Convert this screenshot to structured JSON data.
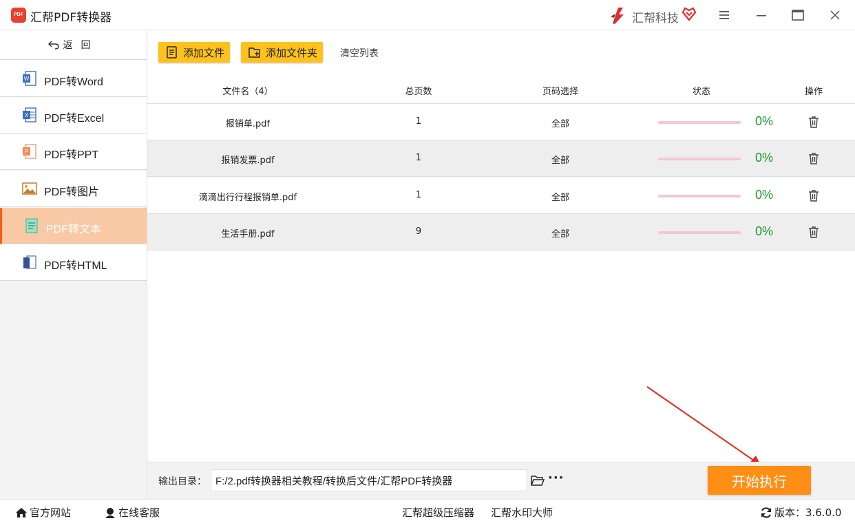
{
  "app": {
    "logo_text": "PDF",
    "title": "汇帮PDF转换器",
    "brand": "汇帮科技"
  },
  "sidebar": {
    "back_label": "返回",
    "items": [
      {
        "label": "PDF转Word",
        "icon": "word-icon"
      },
      {
        "label": "PDF转Excel",
        "icon": "excel-icon"
      },
      {
        "label": "PDF转PPT",
        "icon": "ppt-icon"
      },
      {
        "label": "PDF转图片",
        "icon": "image-icon"
      },
      {
        "label": "PDF转文本",
        "icon": "text-icon",
        "active": true
      },
      {
        "label": "PDF转HTML",
        "icon": "html-icon"
      }
    ]
  },
  "toolbar": {
    "add_file": "添加文件",
    "add_folder": "添加文件夹",
    "clear_list": "清空列表"
  },
  "table": {
    "headers": {
      "name": "文件名（4）",
      "pages": "总页数",
      "range": "页码选择",
      "status": "状态",
      "action": "操作"
    },
    "rows": [
      {
        "name": "报销单.pdf",
        "pages": "1",
        "range": "全部",
        "progress": 0,
        "percent": "0%"
      },
      {
        "name": "报销发票.pdf",
        "pages": "1",
        "range": "全部",
        "progress": 0,
        "percent": "0%"
      },
      {
        "name": "滴滴出行行程报销单.pdf",
        "pages": "1",
        "range": "全部",
        "progress": 0,
        "percent": "0%"
      },
      {
        "name": "生活手册.pdf",
        "pages": "9",
        "range": "全部",
        "progress": 0,
        "percent": "0%"
      }
    ]
  },
  "output": {
    "label": "输出目录：",
    "path": "F:/2.pdf转换器相关教程/转换后文件/汇帮PDF转换器",
    "more": "···",
    "start_button": "开始执行"
  },
  "statusbar": {
    "website": "官方网站",
    "support": "在线客服",
    "compressor": "汇帮超级压缩器",
    "watermark": "汇帮水印大师",
    "version": "版本：3.6.0.0"
  },
  "colors": {
    "accent": "#ffc21c",
    "start": "#ff8e15",
    "active_nav": "#f9c9a5",
    "percent": "#1a9a2e"
  }
}
